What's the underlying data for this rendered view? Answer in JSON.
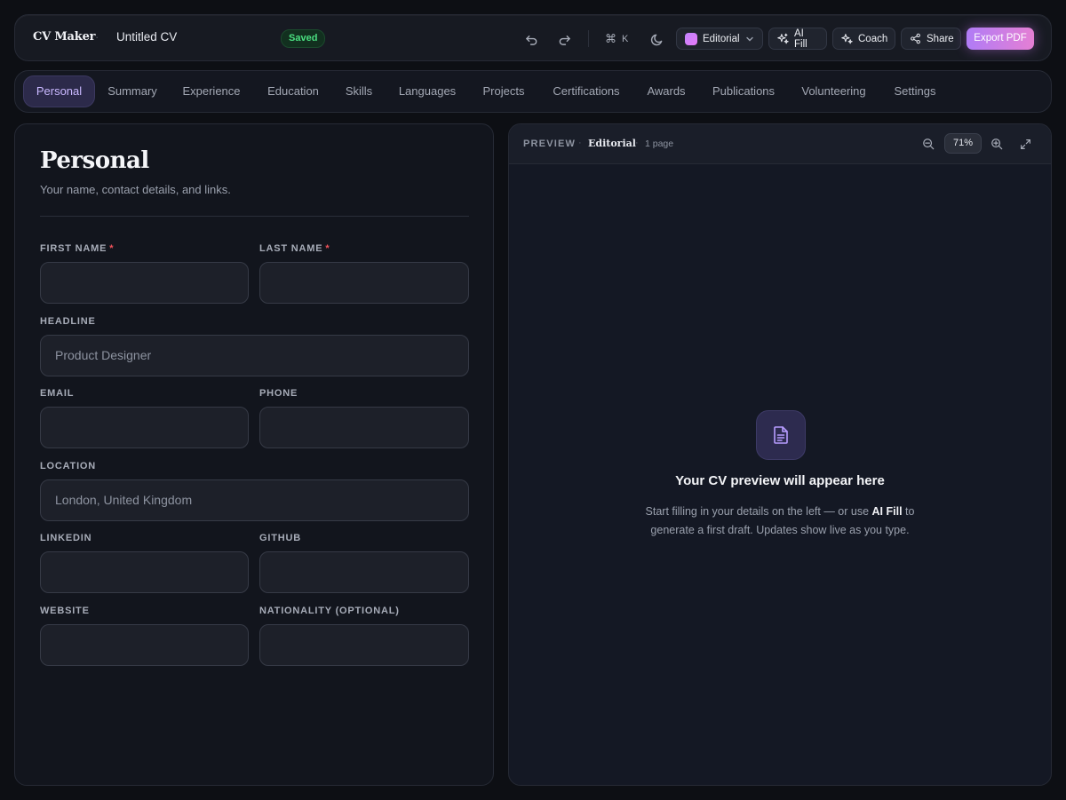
{
  "header": {
    "brand": "CV Maker",
    "separator": "·",
    "doc_title": "Untitled CV",
    "status_badge": "Saved",
    "shortcut_symbol": "⌘",
    "shortcut_key": "K",
    "template_select": "Editorial",
    "ai_fill_label": "AI Fill",
    "coach_label": "Coach",
    "share_label": "Share",
    "export_label": "Export PDF"
  },
  "tabs": [
    {
      "label": "Personal",
      "active": true
    },
    {
      "label": "Summary"
    },
    {
      "label": "Experience"
    },
    {
      "label": "Education"
    },
    {
      "label": "Skills"
    },
    {
      "label": "Languages"
    },
    {
      "label": "Projects"
    },
    {
      "label": "Certifications"
    },
    {
      "label": "Awards"
    },
    {
      "label": "Publications"
    },
    {
      "label": "Volunteering"
    },
    {
      "label": "Settings"
    }
  ],
  "form": {
    "title": "Personal",
    "subtitle": "Your name, contact details, and links.",
    "required_mark": "*",
    "fields": {
      "first_name": {
        "label": "FIRST NAME",
        "value": "",
        "placeholder": ""
      },
      "last_name": {
        "label": "LAST NAME",
        "value": "",
        "placeholder": ""
      },
      "headline": {
        "label": "HEADLINE",
        "value": "",
        "placeholder": "Product Designer"
      },
      "email": {
        "label": "EMAIL",
        "value": "",
        "placeholder": ""
      },
      "phone": {
        "label": "PHONE",
        "value": "",
        "placeholder": ""
      },
      "location": {
        "label": "LOCATION",
        "value": "",
        "placeholder": "London, United Kingdom"
      },
      "linkedin": {
        "label": "LINKEDIN",
        "value": "",
        "placeholder": ""
      },
      "github": {
        "label": "GITHUB",
        "value": "",
        "placeholder": ""
      },
      "website": {
        "label": "WEBSITE",
        "value": "",
        "placeholder": ""
      },
      "nationality": {
        "label": "NATIONALITY (OPTIONAL)",
        "value": "",
        "placeholder": ""
      }
    }
  },
  "preview": {
    "label": "PREVIEW",
    "dot": "·",
    "template": "Editorial",
    "pages": "1 page",
    "zoom": "71%",
    "empty_title": "Your CV preview will appear here",
    "empty_desc_1": "Start filling in your details on the left — or use",
    "empty_desc_bold": "AI Fill",
    "empty_desc_2": "to",
    "empty_desc_3": "generate a first draft. Updates show live as you type."
  },
  "colors": {
    "background": "#0d0f14",
    "accent": "#c9b8ff",
    "saved_green": "#4ade80",
    "required_red": "#f0525a",
    "export_gradient_start": "#b07cf6",
    "export_gradient_end": "#e57fd4"
  },
  "icons": [
    "undo-icon",
    "redo-icon",
    "command-icon",
    "moon-icon",
    "chevron-down-icon",
    "sparkles-icon",
    "share-icon",
    "zoom-out-icon",
    "zoom-in-icon",
    "expand-icon",
    "document-icon"
  ]
}
